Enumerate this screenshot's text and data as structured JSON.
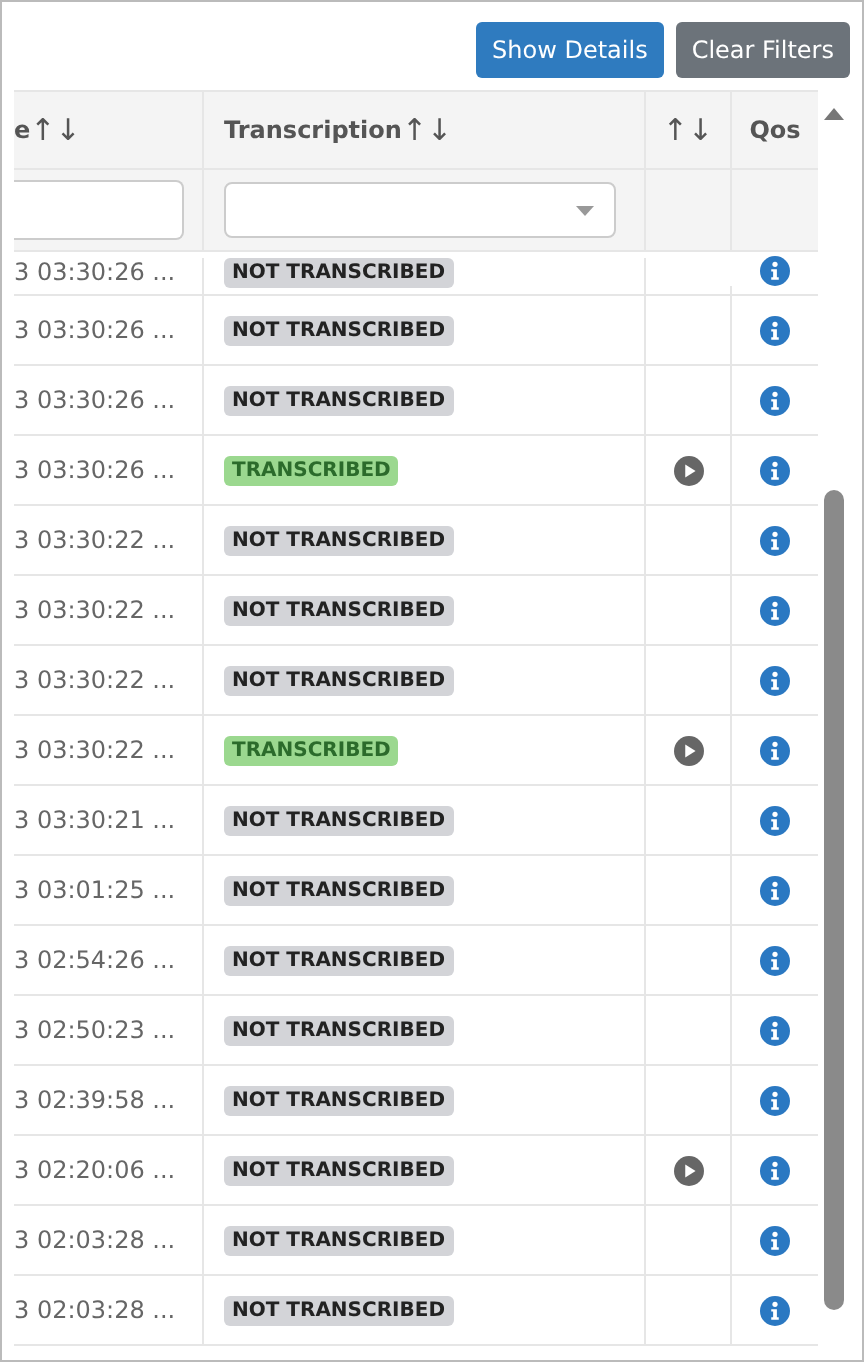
{
  "toolbar": {
    "buttons": [
      {
        "label": "Show Details",
        "kind": "primary"
      },
      {
        "label": "Clear Filters",
        "kind": "secondary"
      }
    ]
  },
  "table": {
    "columns": [
      {
        "label": "e",
        "sort": "↑↓"
      },
      {
        "label": "Transcription",
        "sort": "↑↓"
      },
      {
        "sort": "↑↓"
      },
      {
        "label": "Qos"
      }
    ],
    "filters": [
      {
        "kind": "text"
      },
      {
        "kind": "select"
      },
      {
        "kind": "none"
      },
      {
        "kind": "none"
      }
    ],
    "rows": [
      {
        "time": "3 03:30:26 ...",
        "status": {
          "text": "NOT TRANSCRIBED",
          "kind": "pending"
        },
        "playable": false,
        "partial": true
      },
      {
        "time": "3 03:30:26 ...",
        "status": {
          "text": "NOT TRANSCRIBED",
          "kind": "pending"
        },
        "playable": false
      },
      {
        "time": "3 03:30:26 ...",
        "status": {
          "text": "NOT TRANSCRIBED",
          "kind": "pending"
        },
        "playable": false
      },
      {
        "time": "3 03:30:26 ...",
        "status": {
          "text": "TRANSCRIBED",
          "kind": "done"
        },
        "playable": true
      },
      {
        "time": "3 03:30:22 ...",
        "status": {
          "text": "NOT TRANSCRIBED",
          "kind": "pending"
        },
        "playable": false
      },
      {
        "time": "3 03:30:22 ...",
        "status": {
          "text": "NOT TRANSCRIBED",
          "kind": "pending"
        },
        "playable": false
      },
      {
        "time": "3 03:30:22 ...",
        "status": {
          "text": "NOT TRANSCRIBED",
          "kind": "pending"
        },
        "playable": false
      },
      {
        "time": "3 03:30:22 ...",
        "status": {
          "text": "TRANSCRIBED",
          "kind": "done"
        },
        "playable": true
      },
      {
        "time": "3 03:30:21 ...",
        "status": {
          "text": "NOT TRANSCRIBED",
          "kind": "pending"
        },
        "playable": false
      },
      {
        "time": "3 03:01:25 ...",
        "status": {
          "text": "NOT TRANSCRIBED",
          "kind": "pending"
        },
        "playable": false
      },
      {
        "time": "3 02:54:26 ...",
        "status": {
          "text": "NOT TRANSCRIBED",
          "kind": "pending"
        },
        "playable": false
      },
      {
        "time": "3 02:50:23 ...",
        "status": {
          "text": "NOT TRANSCRIBED",
          "kind": "pending"
        },
        "playable": false
      },
      {
        "time": "3 02:39:58 ...",
        "status": {
          "text": "NOT TRANSCRIBED",
          "kind": "pending"
        },
        "playable": false
      },
      {
        "time": "3 02:20:06 ...",
        "status": {
          "text": "NOT TRANSCRIBED",
          "kind": "pending"
        },
        "playable": true
      },
      {
        "time": "3 02:03:28 ...",
        "status": {
          "text": "NOT TRANSCRIBED",
          "kind": "pending"
        },
        "playable": false
      },
      {
        "time": "3 02:03:28 ...",
        "status": {
          "text": "NOT TRANSCRIBED",
          "kind": "pending"
        },
        "playable": false
      }
    ]
  }
}
